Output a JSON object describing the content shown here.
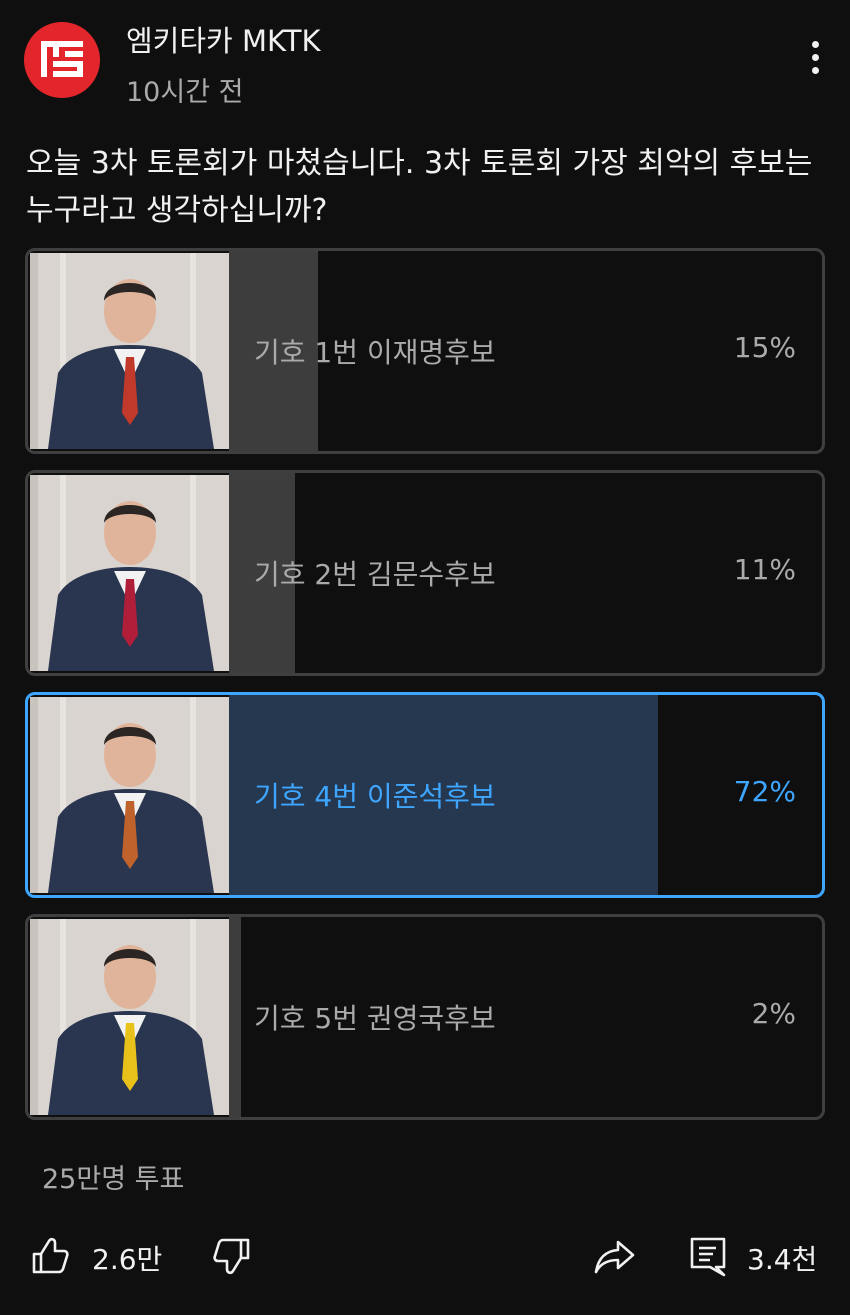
{
  "header": {
    "channel_name": "엠키타카 MKTK",
    "time_ago": "10시간 전",
    "logo_text": "MKTK"
  },
  "post": {
    "question": "오늘 3차 토론회가 마쳤습니다. 3차 토론회 가장 최악의 후보는 누구라고 생각하십니까?"
  },
  "poll": {
    "options": [
      {
        "label": "기호 1번 이재명후보",
        "percent_text": "15%",
        "percent": 15,
        "selected": false,
        "tie_color": "#c0392b"
      },
      {
        "label": "기호 2번 김문수후보",
        "percent_text": "11%",
        "percent": 11,
        "selected": false,
        "tie_color": "#b01e3a"
      },
      {
        "label": "기호 4번 이준석후보",
        "percent_text": "72%",
        "percent": 72,
        "selected": true,
        "tie_color": "#c0622b"
      },
      {
        "label": "기호 5번 권영국후보",
        "percent_text": "2%",
        "percent": 2,
        "selected": false,
        "tie_color": "#e8c21a"
      }
    ],
    "total_votes": "25만명 투표"
  },
  "actions": {
    "like_count": "2.6만",
    "comment_count": "3.4천"
  },
  "colors": {
    "background": "#0f0f0f",
    "accent": "#3ea6ff",
    "bar": "#3d3d3d",
    "selected_bar": "#263850",
    "logo_red": "#e3262c"
  }
}
